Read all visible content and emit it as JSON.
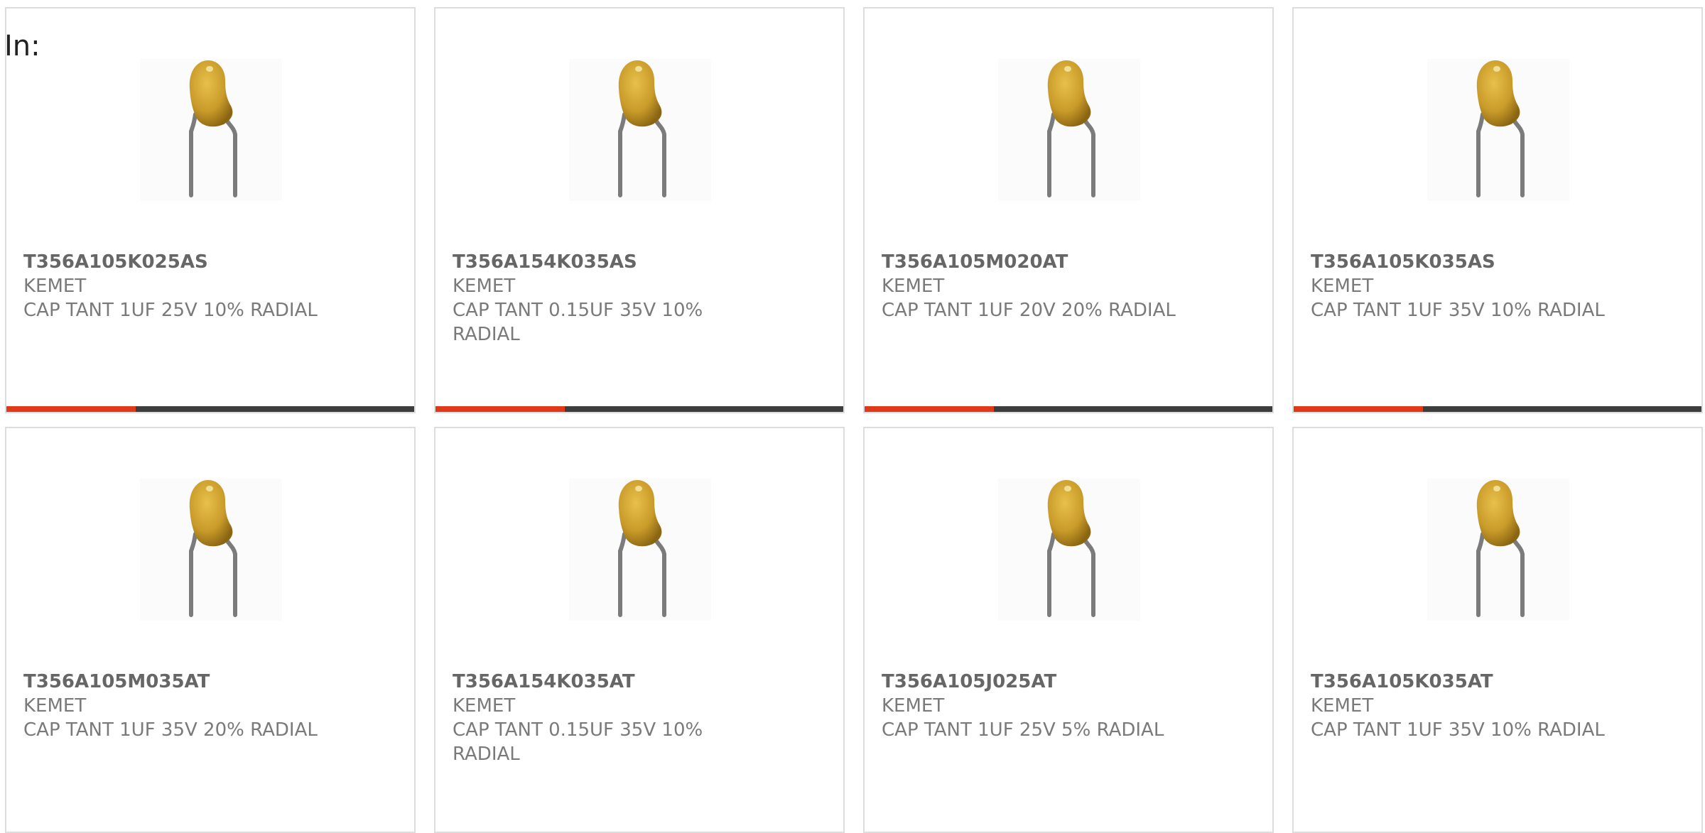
{
  "page": {
    "label": "In:"
  },
  "colors": {
    "accent_bar": "#e0391a",
    "bar_track": "#3d3d3d",
    "card_border": "#dddddd",
    "part_number": "#666666",
    "meta_text": "#7a7a7a",
    "capacitor_body": "#c99b2a"
  },
  "product_image_icon": "tantalum-capacitor-icon",
  "products": [
    {
      "part_number": "T356A105K025AS",
      "manufacturer": "KEMET",
      "description": "CAP TANT 1UF 25V 10% RADIAL",
      "has_accent_bar": true
    },
    {
      "part_number": "T356A154K035AS",
      "manufacturer": "KEMET",
      "description": "CAP TANT 0.15UF 35V 10% RADIAL",
      "has_accent_bar": true
    },
    {
      "part_number": "T356A105M020AT",
      "manufacturer": "KEMET",
      "description": "CAP TANT 1UF 20V 20% RADIAL",
      "has_accent_bar": true
    },
    {
      "part_number": "T356A105K035AS",
      "manufacturer": "KEMET",
      "description": "CAP TANT 1UF 35V 10% RADIAL",
      "has_accent_bar": true
    },
    {
      "part_number": "T356A105M035AT",
      "manufacturer": "KEMET",
      "description": "CAP TANT 1UF 35V 20% RADIAL",
      "has_accent_bar": false
    },
    {
      "part_number": "T356A154K035AT",
      "manufacturer": "KEMET",
      "description": "CAP TANT 0.15UF 35V 10% RADIAL",
      "has_accent_bar": false
    },
    {
      "part_number": "T356A105J025AT",
      "manufacturer": "KEMET",
      "description": "CAP TANT 1UF 25V 5% RADIAL",
      "has_accent_bar": false
    },
    {
      "part_number": "T356A105K035AT",
      "manufacturer": "KEMET",
      "description": "CAP TANT 1UF 35V 10% RADIAL",
      "has_accent_bar": false
    }
  ]
}
